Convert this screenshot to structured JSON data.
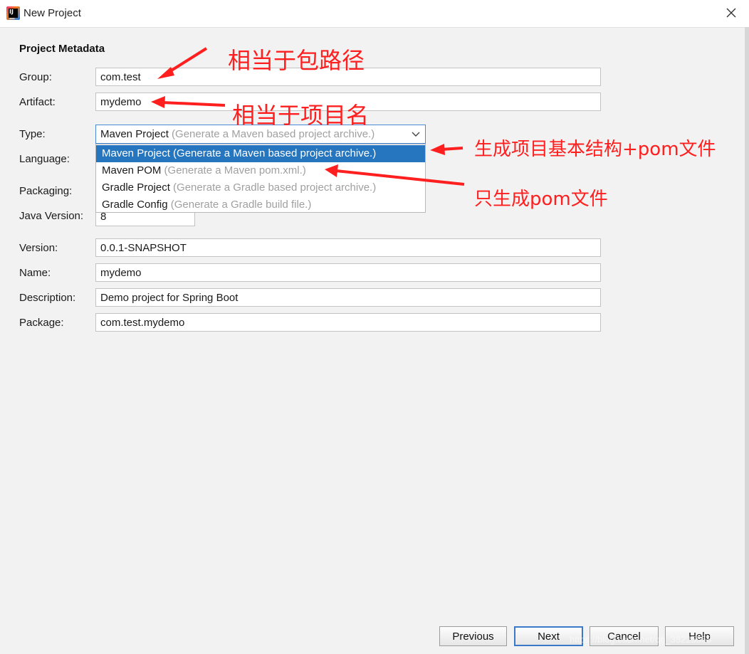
{
  "window": {
    "title": "New Project"
  },
  "section_title": "Project Metadata",
  "fields": {
    "group": {
      "label": "Group:",
      "value": "com.test"
    },
    "artifact": {
      "label": "Artifact:",
      "value": "mydemo"
    },
    "type": {
      "label": "Type:",
      "value": "Maven Project",
      "hint": "(Generate a Maven based project archive.)"
    },
    "language": {
      "label": "Language:"
    },
    "packaging": {
      "label": "Packaging:"
    },
    "java_version": {
      "label": "Java Version:",
      "value": "8"
    },
    "version": {
      "label": "Version:",
      "value": "0.0.1-SNAPSHOT"
    },
    "name": {
      "label": "Name:",
      "value": "mydemo"
    },
    "description": {
      "label": "Description:",
      "value": "Demo project for Spring Boot"
    },
    "package": {
      "label": "Package:",
      "value": "com.test.mydemo"
    }
  },
  "type_options": [
    {
      "name": "Maven Project",
      "hint": "(Generate a Maven based project archive.)",
      "selected": true
    },
    {
      "name": "Maven POM",
      "hint": "(Generate a Maven pom.xml.)",
      "selected": false
    },
    {
      "name": "Gradle Project",
      "hint": "(Generate a Gradle based project archive.)",
      "selected": false
    },
    {
      "name": "Gradle Config",
      "hint": "(Generate a Gradle build file.)",
      "selected": false
    }
  ],
  "annotations": {
    "group_note": "相当于包路径",
    "artifact_note": "相当于项目名",
    "maven_project_note": "生成项目基本结构+pom文件",
    "maven_pom_note": "只生成pom文件"
  },
  "buttons": {
    "previous": "Previous",
    "next": "Next",
    "cancel": "Cancel",
    "help": "Help"
  },
  "watermark": "https://blog.csdn.net/qq_38225558",
  "colors": {
    "selection": "#2675bf",
    "annotation": "#ff1f1f",
    "focus_border": "#4a8ad6"
  }
}
